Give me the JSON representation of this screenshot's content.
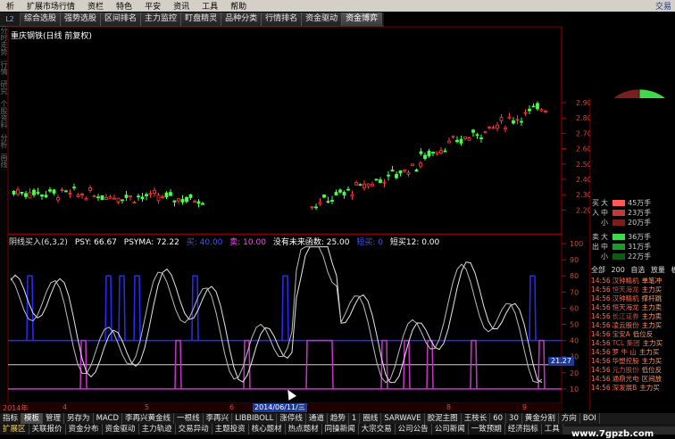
{
  "menu": {
    "items": [
      "析",
      "扩展市场行情",
      "资栏",
      "特色",
      "平安",
      "资讯",
      "工具",
      "帮助"
    ],
    "right_label": "交易"
  },
  "tabs": {
    "level": "L2",
    "items": [
      "综合选股",
      "强势选股",
      "区间排名",
      "主力监控",
      "盯盘精灵",
      "品种分类",
      "行情排名",
      "资金驱动",
      "资金博弈"
    ]
  },
  "chart_header": {
    "title": "重庆钢铁(日线 前复权)"
  },
  "left_strip": [
    "分时走势",
    "行情",
    "研究",
    "个股资料",
    "分析",
    "画线"
  ],
  "price_axis": {
    "ticks": [
      "2.90",
      "2.80",
      "2.70",
      "2.60",
      "2.50",
      "2.40",
      "2.30",
      "2.20"
    ]
  },
  "indicator": {
    "name": "阴线买入(6,3,2)",
    "psy_label": "PSY: 66.67",
    "psyma_label": "PSYMA: 72.22",
    "buy_label": "买: 40.00",
    "sell_label": "卖: 10.00",
    "future_label": "没有未来函数: 25.00",
    "green_label": "短买: 0",
    "super_label": "短买12: 0.00",
    "axis_ticks": [
      "100",
      "90",
      "80",
      "70",
      "60",
      "50",
      "40",
      "30",
      "20",
      "10"
    ],
    "current_value": "21.27"
  },
  "date_axis": {
    "labels": [
      "2014年",
      "4",
      "5",
      "6",
      "7",
      "8",
      "9"
    ],
    "cursor_date": "2014/06/11/三"
  },
  "right_panel": {
    "colors": {
      "big_in": "#ff5a5a",
      "mid_in": "#c23b3b",
      "small_in": "#7a1e1e",
      "big_out": "#3fd94a",
      "mid_out": "#1f9a2a",
      "small_out": "#0f5a16"
    },
    "inflow": [
      {
        "side": "买",
        "size": "大",
        "value": "45万手"
      },
      {
        "side": "入",
        "size": "中",
        "value": "23万手"
      },
      {
        "side": "",
        "size": "小",
        "value": "20万手"
      }
    ],
    "outflow": [
      {
        "side": "卖",
        "size": "大",
        "value": "36万手"
      },
      {
        "side": "出",
        "size": "中",
        "value": "31万手"
      },
      {
        "side": "",
        "size": "小",
        "value": "22万手"
      }
    ],
    "stats": [
      "全部",
      "200",
      "自选",
      "放量",
      "板"
    ],
    "ticks": [
      {
        "time": "14:56",
        "name": "汉钟精机",
        "signal": "单笔冲"
      },
      {
        "time": "14:56",
        "name": "恒天海龙",
        "signal": "主力买"
      },
      {
        "time": "14:56",
        "name": "汉钟精机",
        "signal": "撑杆跳"
      },
      {
        "time": "14:56",
        "name": "恒天海龙",
        "signal": "主力卖"
      },
      {
        "time": "14:56",
        "name": "长江证券",
        "signal": "主力卖"
      },
      {
        "time": "14:56",
        "name": "凌云股份",
        "signal": "主力买"
      },
      {
        "time": "14:56",
        "name": "宝安A",
        "signal": "低位反"
      },
      {
        "time": "14:56",
        "name": "TCL 集团",
        "signal": "主力买"
      },
      {
        "time": "14:56",
        "name": "罗 牛 山",
        "signal": "主力买"
      },
      {
        "time": "14:56",
        "name": "华塑控股",
        "signal": "主力买"
      },
      {
        "time": "14:56",
        "name": "元力股份",
        "signal": "低位反"
      },
      {
        "time": "14:56",
        "name": "通鼎光电",
        "signal": "区间放"
      },
      {
        "time": "14:56",
        "name": "深发展B",
        "signal": "主力买"
      }
    ]
  },
  "bottom_bar1": [
    "指标",
    "模板",
    "管理",
    "另存为",
    "MACD",
    "李再兴黄金线",
    "一根线",
    "李再兴",
    "LIBBIBOLL",
    "涨停线",
    "通道",
    "趋势",
    "1",
    "圈线",
    "SARWAVE",
    "胶泥主图",
    "王枝长",
    "60",
    "30",
    "黄金分割",
    "方向",
    "BOI"
  ],
  "bottom_bar2": [
    "扩展区",
    "关联报价",
    "资金分布",
    "资金驱动",
    "主力轨迹",
    "交易异动",
    "主题投资",
    "核心题材",
    "热点题材",
    "同操新闻",
    "大宗交易",
    "公司公告",
    "公司新闻",
    "一致预期",
    "经济指标",
    "工具"
  ],
  "watermark": "www.7gpzb.com"
}
